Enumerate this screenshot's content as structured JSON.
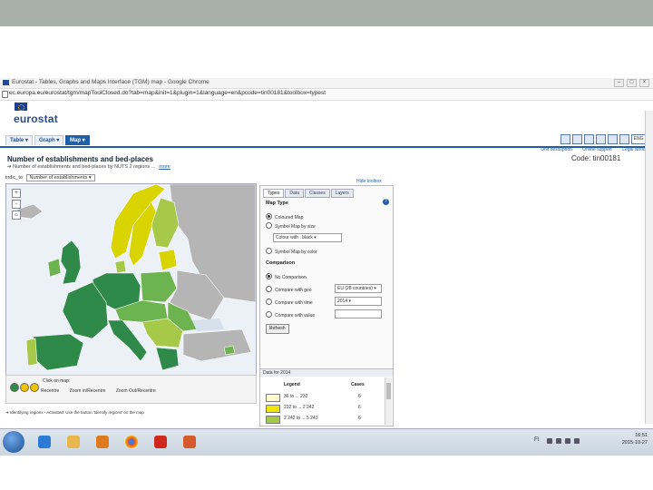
{
  "browser": {
    "tab_title": "Eurostat - Tables, Graphs and Maps Interface (TGM) map - Google Chrome",
    "url": "ec.europa.eu/eurostat/tgm/mapToolClosed.do?tab=map&init=1&plugin=1&language=en&pcode=tin00181&toolbox=typest",
    "window_buttons": [
      "–",
      "□",
      "×"
    ]
  },
  "site": {
    "logo": "eurostat",
    "nav_tabs": [
      {
        "label": "Table ▾"
      },
      {
        "label": "Graph ▾"
      },
      {
        "label": "Map ▾"
      }
    ],
    "tools_lang": "ENG ▾",
    "sublinks": [
      "Unit description",
      "Online support",
      "Legal Notice"
    ]
  },
  "dataset": {
    "title": "Number of establishments and bed-places",
    "code": "Code: tin00181",
    "description": "➔ Number of establishments and bed-places by NUTS 2 regions ...",
    "more": "more",
    "indicator_label": "indic_to",
    "indicator_value": "Number of establishments ▾"
  },
  "map": {
    "zoom": [
      "+",
      "−",
      "⌂"
    ],
    "click_label": "Click on map:",
    "click_options": [
      "Recentre",
      "Zoom in/Recentre",
      "Zoom Out/Recentre"
    ],
    "footnote": "➔ Identifying regions - Activated: Use the button 'Identify regions' on the map"
  },
  "toolbox": {
    "hide_link": "Hide toolbox",
    "tabs": [
      "Types",
      "Data",
      "Classes",
      "Layers"
    ],
    "map_type_heading": "Map Type",
    "map_types": [
      {
        "label": "Coloured Map",
        "checked": true
      },
      {
        "label": "Symbol Map by size",
        "checked": false
      },
      {
        "label": "Symbol Map by color",
        "checked": false
      }
    ],
    "colour_label": "Colour with : black ▾",
    "comparison_heading": "Comparison",
    "comparisons": [
      {
        "label": "No Comparison",
        "checked": true
      },
      {
        "label": "Compare with geo",
        "checked": false
      },
      {
        "label": "Compare with time",
        "checked": false
      },
      {
        "label": "Compare with value",
        "checked": false
      }
    ],
    "geo_select": "EU (28 countries) ▾",
    "time_select": "2014 ▾",
    "refresh": "Refresh"
  },
  "data_panel": {
    "header": "Data for 2014",
    "col_legend": "Legend",
    "col_cases": "Cases",
    "rows": [
      {
        "range": "36 to ... 232",
        "cases": "6",
        "color": "#fffccc"
      },
      {
        "range": "232 to ... 2 242",
        "cases": "6",
        "color": "#f2e600"
      },
      {
        "range": "2 242 to ... 5 243",
        "cases": "6",
        "color": "#a7c94a"
      }
    ]
  },
  "taskbar": {
    "lang": "FI",
    "time": "16:51",
    "date": "2015-10-27"
  },
  "colors": {
    "sea": "#ecf1f7",
    "dark_green": "#2f8a4a",
    "mid_green": "#6db34f",
    "light_green": "#a7c94a",
    "yellow": "#d9d300",
    "pale": "#fffccc",
    "grey": "#b5b5b5"
  }
}
